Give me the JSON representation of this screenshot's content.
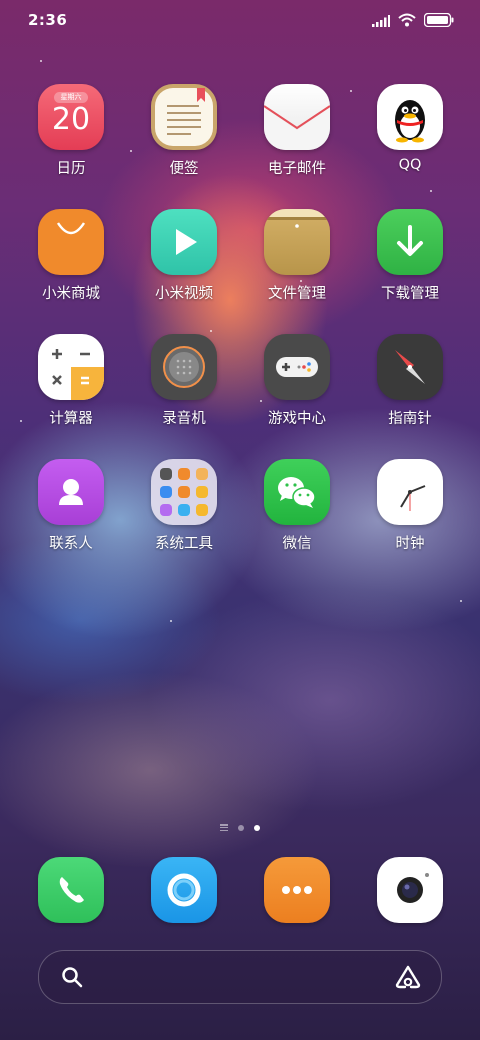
{
  "status_bar": {
    "time": "2:36",
    "icons": [
      "signal-icon",
      "wifi-icon",
      "battery-icon"
    ]
  },
  "apps": [
    {
      "label": "日历",
      "icon": "calendar-icon",
      "calendar_header": "星期六",
      "calendar_day": "20",
      "color": "#ef4f62"
    },
    {
      "label": "便签",
      "icon": "notes-icon",
      "color": "#c9a56a"
    },
    {
      "label": "电子邮件",
      "icon": "mail-icon",
      "color": "#f2f2f2"
    },
    {
      "label": "QQ",
      "icon": "qq-penguin-icon",
      "color": "#ffffff"
    },
    {
      "label": "小米商城",
      "icon": "shopping-bag-icon",
      "color": "#f08a2c"
    },
    {
      "label": "小米视频",
      "icon": "play-icon",
      "color": "#3fd1b4"
    },
    {
      "label": "文件管理",
      "icon": "folder-icon",
      "color": "#c9a85a"
    },
    {
      "label": "下载管理",
      "icon": "download-arrow-icon",
      "color": "#3fbf4f"
    },
    {
      "label": "计算器",
      "icon": "calculator-icon",
      "color": "#ffffff"
    },
    {
      "label": "录音机",
      "icon": "recorder-icon",
      "color": "#4a4a4a"
    },
    {
      "label": "游戏中心",
      "icon": "gamepad-icon",
      "color": "#4a4a4a"
    },
    {
      "label": "指南针",
      "icon": "compass-icon",
      "color": "#3a3a3a"
    },
    {
      "label": "联系人",
      "icon": "contact-person-icon",
      "color": "#b84fe0"
    },
    {
      "label": "系统工具",
      "icon": "folder-apps-icon",
      "color": "#dcd6e6"
    },
    {
      "label": "微信",
      "icon": "wechat-icon",
      "color": "#2ec14a"
    },
    {
      "label": "时钟",
      "icon": "clock-icon",
      "color": "#ffffff"
    }
  ],
  "page_indicator": {
    "pages": 3,
    "active": 2
  },
  "dock": [
    {
      "icon": "phone-icon",
      "color": "#3fce6a"
    },
    {
      "icon": "messages-icon",
      "color": "#2aa6ef"
    },
    {
      "icon": "more-dots-icon",
      "color": "#f08a2c"
    },
    {
      "icon": "camera-icon",
      "color": "#ffffff"
    }
  ],
  "search_bar": {
    "left_icon": "search-icon",
    "right_icon": "assistant-a-icon"
  }
}
